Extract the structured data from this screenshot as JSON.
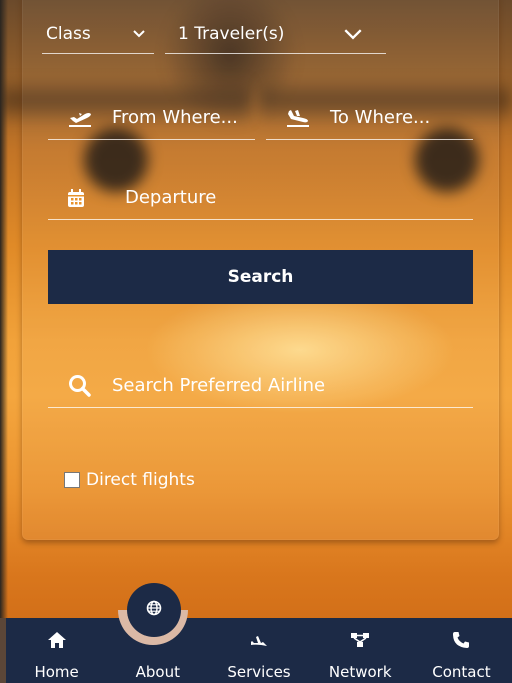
{
  "form": {
    "class_label": "Class",
    "travelers_label": "1 Traveler(s)",
    "from_placeholder": "From Where...",
    "to_placeholder": "To Where...",
    "departure_placeholder": "Departure",
    "search_button": "Search",
    "airline_placeholder": "Search Preferred Airline",
    "direct_flights_label": "Direct flights",
    "direct_flights_checked": false
  },
  "nav": {
    "items": [
      {
        "label": "Home",
        "icon": "home-icon"
      },
      {
        "label": "About",
        "icon": "globe-icon"
      },
      {
        "label": "Services",
        "icon": "services-icon"
      },
      {
        "label": "Network",
        "icon": "network-icon"
      },
      {
        "label": "Contact",
        "icon": "phone-icon"
      }
    ]
  },
  "colors": {
    "nav_bg": "#1c2a46",
    "button_bg": "#1c2a46",
    "badge_ring": "#dbb9a6"
  }
}
